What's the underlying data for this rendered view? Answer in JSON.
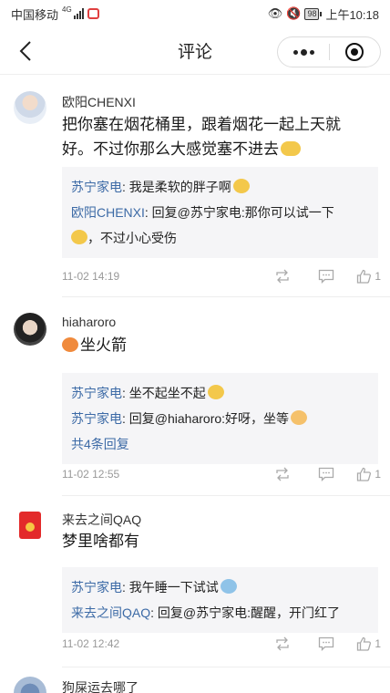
{
  "status_bar": {
    "carrier": "中国移动",
    "network": "4G",
    "battery": "98",
    "time": "上午10:18"
  },
  "header": {
    "title": "评论"
  },
  "comments": [
    {
      "username": "欧阳CHENXI",
      "text": "把你塞在烟花桶里，跟着烟花一起上天就好。不过你那么大感觉塞不进去",
      "replies": [
        {
          "name": "苏宁家电",
          "text": ": 我是柔软的胖子啊"
        },
        {
          "name": "欧阳CHENXI",
          "text": ": 回复@苏宁家电:那你可以试一下",
          "cont": "，不过小心受伤"
        }
      ],
      "time": "11-02 14:19",
      "likes": "1"
    },
    {
      "username": "hiaharoro",
      "text": "坐火箭",
      "replies": [
        {
          "name": "苏宁家电",
          "text": ": 坐不起坐不起"
        },
        {
          "name": "苏宁家电",
          "text": ": 回复@hiaharoro:好呀，坐等"
        }
      ],
      "more_replies": "共4条回复",
      "time": "11-02 12:55",
      "likes": "1"
    },
    {
      "username": "来去之间QAQ",
      "text": "梦里啥都有",
      "replies": [
        {
          "name": "苏宁家电",
          "text": ": 我午睡一下试试"
        },
        {
          "name": "来去之间QAQ",
          "text": ": 回复@苏宁家电:醒醒，开门红了"
        }
      ],
      "time": "11-02 12:42",
      "likes": "1"
    },
    {
      "username": "狗屎运去哪了"
    }
  ]
}
